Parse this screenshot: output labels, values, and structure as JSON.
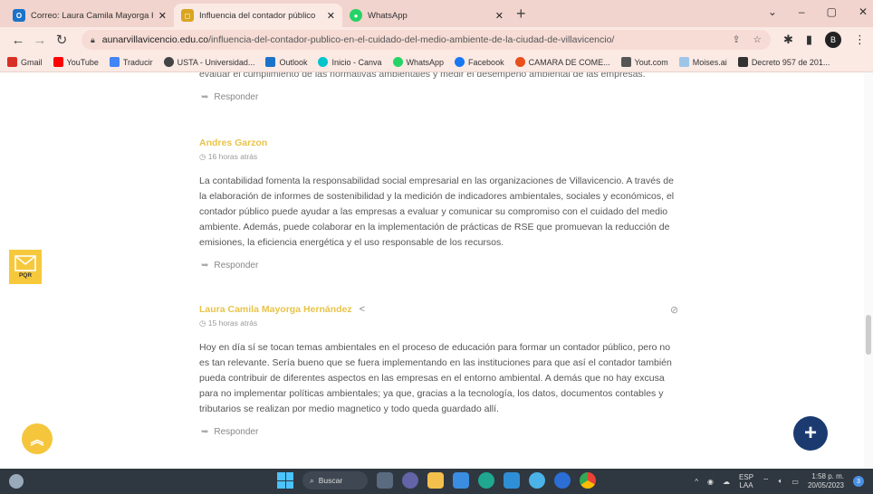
{
  "browser": {
    "tabs": [
      {
        "title": "Correo: Laura Camila Mayorga H",
        "icon": "outlook-icon",
        "color": "#1a73c9"
      },
      {
        "title": "Influencia del contador público",
        "icon": "site-icon",
        "color": "#d9a520"
      },
      {
        "title": "WhatsApp",
        "icon": "whatsapp-icon",
        "color": "#25d366"
      }
    ],
    "new_tab": "+",
    "window_controls": [
      "⌄",
      "–",
      "▢",
      "✕"
    ],
    "url_domain": "aunarvillavicencio.edu.co",
    "url_path": "/influencia-del-contador-publico-en-el-cuidado-del-medio-ambiente-de-la-ciudad-de-villavicencio/",
    "bookmarks": [
      {
        "label": "Gmail",
        "color": "#d93025"
      },
      {
        "label": "YouTube",
        "color": "#ff0000"
      },
      {
        "label": "Traducir",
        "color": "#4285f4"
      },
      {
        "label": "USTA - Universidad...",
        "color": "#444444"
      },
      {
        "label": "Outlook",
        "color": "#1a73c9"
      },
      {
        "label": "Inicio - Canva",
        "color": "#00c4cc"
      },
      {
        "label": "WhatsApp",
        "color": "#25d366"
      },
      {
        "label": "Facebook",
        "color": "#1877f2"
      },
      {
        "label": "CAMARA DE COME...",
        "color": "#e94e1b"
      },
      {
        "label": "Yout.com",
        "color": "#555555"
      },
      {
        "label": "Moises.ai",
        "color": "#9ec5e8"
      },
      {
        "label": "Decreto 957 de 201...",
        "color": "#333333"
      }
    ]
  },
  "page": {
    "clipped_text": "evaluar el cumplimiento de las normativas ambientales y medir el desempeño ambiental de las empresas.",
    "reply_label": "Responder",
    "comments": [
      {
        "author": "Andres Garzon",
        "time": "16 horas atrás",
        "body": "La contabilidad fomenta la responsabilidad social empresarial en las organizaciones de Villavicencio. A través de la elaboración de informes de sostenibilidad y la medición de indicadores ambientales, sociales y económicos, el contador público puede ayudar a las empresas a evaluar y comunicar su compromiso con el cuidado del medio ambiente. Además, puede colaborar en la implementación de prácticas de RSE que promuevan la reducción de emisiones, la eficiencia energética y el uso responsable de los recursos."
      },
      {
        "author": "Laura Camila Mayorga Hernández",
        "time": "15 horas atrás",
        "body": "Hoy en día sí se tocan temas ambientales en el proceso de educación para formar un contador público, pero no es tan relevante. Sería bueno que se fuera implementando en las instituciones para que así el contador también pueda contribuir de diferentes aspectos en las empresas en el entorno ambiental. A demás que no hay excusa para no implementar políticas ambientales; ya que, gracias a la tecnología, los datos, documentos contables y tributarios se realizan por medio magnetico y todo queda guardado allí."
      }
    ],
    "pqr_label": "PQR",
    "accent_color": "#e8c34a"
  },
  "taskbar": {
    "search_label": "Buscar",
    "lang_top": "ESP",
    "lang_bottom": "LAA",
    "time": "1:58 p. m.",
    "date": "20/05/2023",
    "notification_count": "3"
  }
}
